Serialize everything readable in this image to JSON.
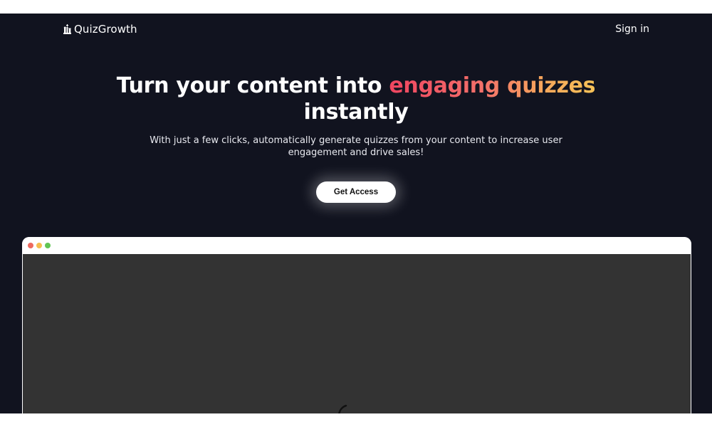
{
  "brand": {
    "name": "QuizGrowth",
    "icon": "chess-pieces-icon"
  },
  "nav": {
    "sign_in": "Sign in"
  },
  "hero": {
    "title_start": "Turn your content into ",
    "title_highlight": "engaging quizzes",
    "title_end": "instantly",
    "subtitle": "With just a few clicks, automatically generate quizzes from your content to increase user engagement and drive sales!",
    "cta_label": "Get Access"
  },
  "preview": {
    "window_controls": [
      "close-dot",
      "minimize-dot",
      "maximize-dot"
    ],
    "loading_icon": "spinner-icon"
  },
  "colors": {
    "background": "#11131f",
    "gradient_start": "#ef4560",
    "gradient_end": "#f7c257",
    "preview_content": "#333333"
  }
}
